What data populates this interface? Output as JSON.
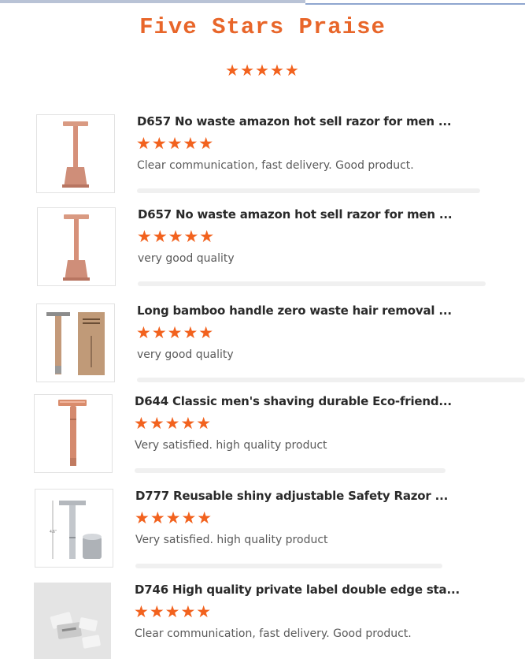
{
  "page": {
    "title": "Five Stars Praise",
    "header_stars": "★★★★★",
    "accent_color": "#f2621e"
  },
  "reviews": [
    {
      "title": "D657 No waste amazon hot sell razor for men ...",
      "stars": "★★★★★",
      "rating": 5,
      "comment": "Clear communication, fast delivery. Good product.",
      "image": "rose-gold-razor-on-stand"
    },
    {
      "title": "D657 No waste amazon hot sell razor for men ...",
      "stars": "★★★★★",
      "rating": 5,
      "comment": "very good quality",
      "image": "rose-gold-razor-on-stand"
    },
    {
      "title": "Long bamboo handle zero waste hair removal ...",
      "stars": "★★★★★",
      "rating": 5,
      "comment": "very good quality",
      "image": "bamboo-razor-with-box"
    },
    {
      "title": "D644 Classic men's shaving durable Eco-friend...",
      "stars": "★★★★★",
      "rating": 5,
      "comment": "Very satisfied. high quality product",
      "image": "copper-safety-razor"
    },
    {
      "title": "D777 Reusable shiny adjustable Safety Razor ...",
      "stars": "★★★★★",
      "rating": 5,
      "comment": "Very satisfied. high quality product",
      "image": "silver-razor-with-stand"
    },
    {
      "title": "D746 High quality private label double edge sta...",
      "stars": "★★★★★",
      "rating": 5,
      "comment": "Clear communication, fast delivery. Good product.",
      "image": "double-edge-blades"
    }
  ]
}
